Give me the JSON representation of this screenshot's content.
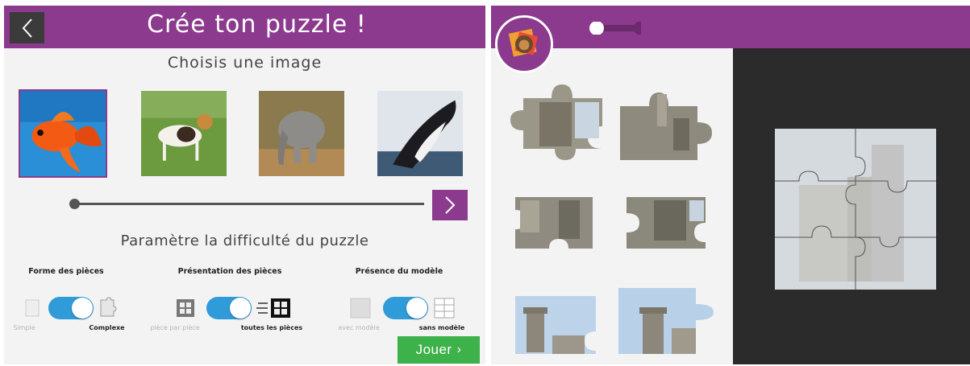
{
  "left_screen": {
    "title": "Crée ton puzzle !",
    "choose_image": "Choisis une image",
    "images": [
      {
        "name": "goldfish",
        "selected": true
      },
      {
        "name": "dog",
        "selected": false
      },
      {
        "name": "elephant",
        "selected": false
      },
      {
        "name": "whale",
        "selected": false
      }
    ],
    "difficulty_title": "Paramètre la difficulté du puzzle",
    "groups": {
      "shape": {
        "label": "Forme des pièces",
        "left_option": "Simple",
        "right_option": "Complexe",
        "selected": "right"
      },
      "presentation": {
        "label": "Présentation des pièces",
        "left_option": "pièce par pièce",
        "right_option": "toutes les pièces",
        "selected": "right"
      },
      "model": {
        "label": "Présence du modèle",
        "left_option": "avec modèle",
        "right_option": "sans modèle",
        "selected": "right"
      }
    },
    "play_button": "Jouer",
    "colors": {
      "accent": "#8c3a8e",
      "toggle": "#2f9bd8",
      "play": "#3db14a",
      "back": "#3b3b3b"
    }
  },
  "right_screen": {
    "pieces_count": 6,
    "colors": {
      "board": "#2b2b2b",
      "accent": "#8c3a8e"
    }
  }
}
